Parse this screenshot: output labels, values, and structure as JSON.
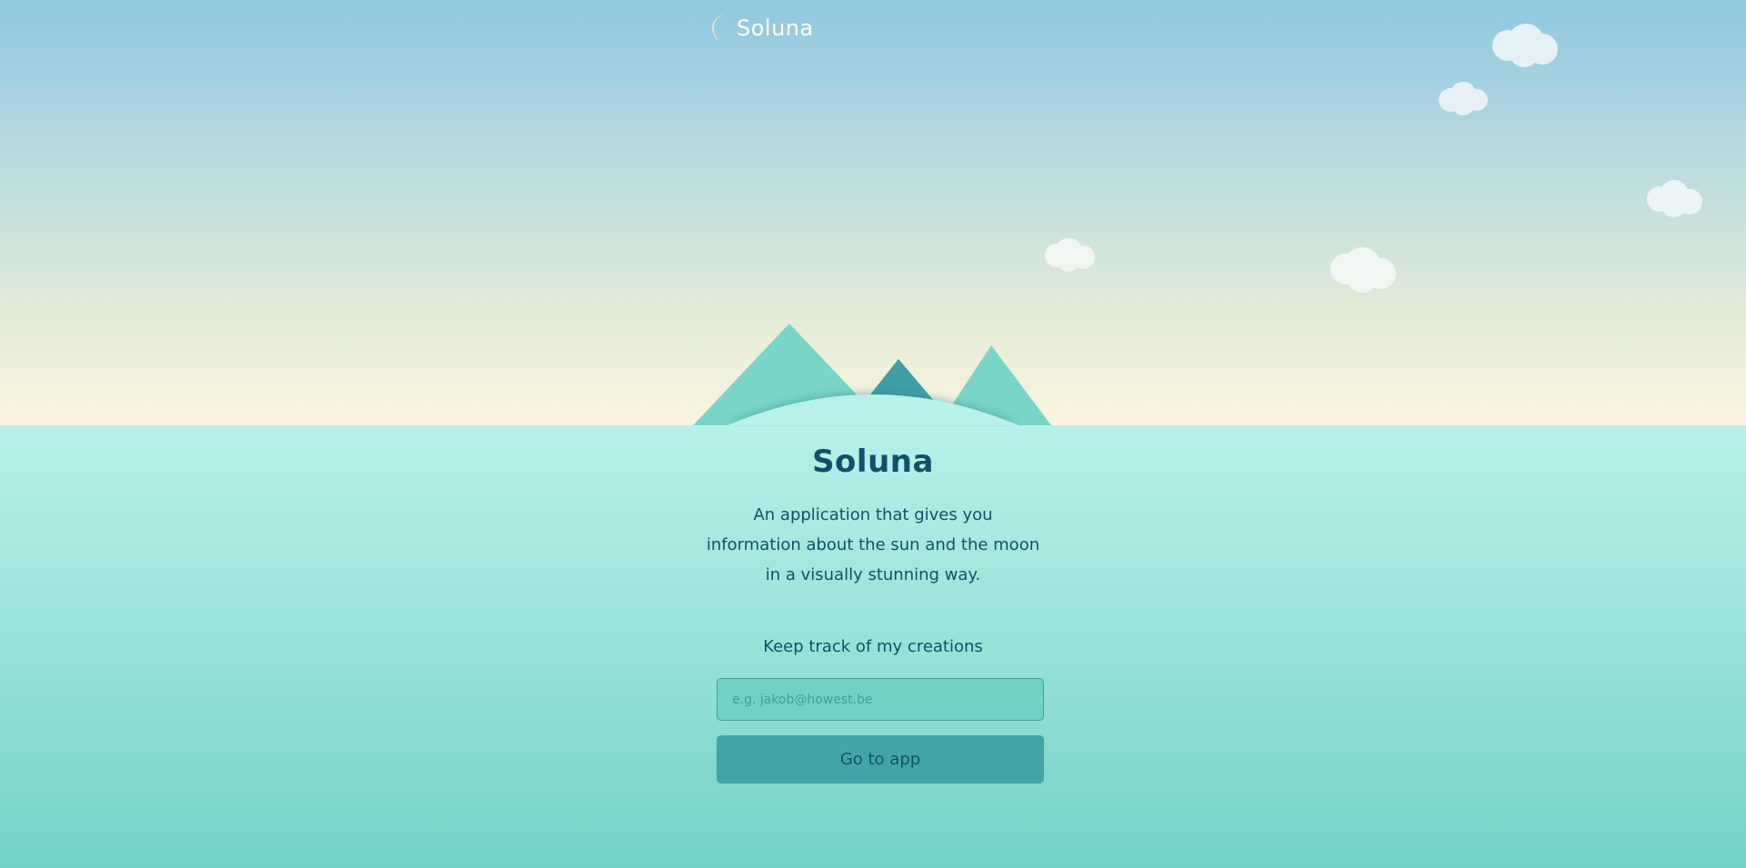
{
  "header": {
    "logo_text": "Soluna",
    "logo_icon": "crescent-moon-icon"
  },
  "hero": {
    "title": "Soluna",
    "description": "An application that gives you information about the sun and the moon in a visually stunning way."
  },
  "signup": {
    "label": "Keep track of my creations",
    "email_placeholder": "e.g. jakob@howest.be",
    "email_value": "",
    "button_label": "Go to app"
  },
  "colors": {
    "sky_top": "#8fc8e0",
    "sky_bottom": "#fbf5df",
    "ground_top": "#b8f0ea",
    "ground_bottom": "#72d2c7",
    "text": "#11506a",
    "input_bg": "#72d1c5",
    "button_bg": "#42a4a6",
    "mountain_light": "#79d5c8",
    "mountain_dark": "#3f9fa3",
    "moon": "#f2dcc0",
    "cloud": "#eaf4f5"
  }
}
